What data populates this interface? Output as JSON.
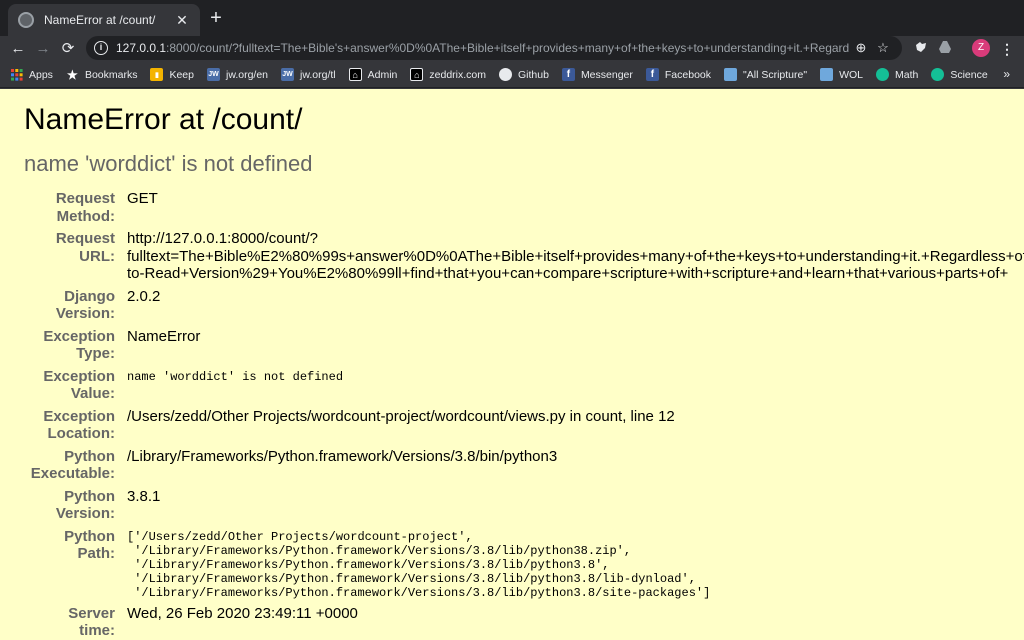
{
  "tab": {
    "title": "NameError at /count/",
    "close": "✕"
  },
  "new_tab_label": "+",
  "toolbar": {
    "back": "←",
    "forward": "→",
    "reload": "⟳",
    "url_host": "127.0.0.1",
    "url_rest": ":8000/count/?fulltext=The+Bible's+answer%0D%0AThe+Bible+itself+provides+many+of+the+keys+to+understanding+it.+Regardless...",
    "zoom": "⊕",
    "star": "☆",
    "profile_initial": "Z",
    "menu": "⋮"
  },
  "bookmarks": [
    {
      "label": "Apps",
      "icon": "apps-grid-icon",
      "color": "#4285f4"
    },
    {
      "label": "Bookmarks",
      "icon": "star-icon",
      "color": "#35363a"
    },
    {
      "label": "Keep",
      "icon": "keep-icon",
      "color": "#f4b400"
    },
    {
      "label": "jw.org/en",
      "icon": "jw-icon",
      "color": "#4a6da7"
    },
    {
      "label": "jw.org/tl",
      "icon": "jw-icon",
      "color": "#4a6da7"
    },
    {
      "label": "Admin",
      "icon": "home-icon",
      "color": "#000000"
    },
    {
      "label": "zeddrix.com",
      "icon": "home-icon",
      "color": "#000000"
    },
    {
      "label": "Github",
      "icon": "github-icon",
      "color": "#111111"
    },
    {
      "label": "Messenger",
      "icon": "facebook-icon",
      "color": "#3b5998"
    },
    {
      "label": "Facebook",
      "icon": "facebook-icon",
      "color": "#3b5998"
    },
    {
      "label": "\"All Scripture\"",
      "icon": "book-icon",
      "color": "#6fa8dc"
    },
    {
      "label": "WOL",
      "icon": "book-icon",
      "color": "#6fa8dc"
    },
    {
      "label": "Math",
      "icon": "khan-icon",
      "color": "#14bf96"
    },
    {
      "label": "Science",
      "icon": "khan-icon",
      "color": "#14bf96"
    }
  ],
  "bookmarks_more": "»",
  "error": {
    "title": "NameError at /count/",
    "subtitle": "name 'worddict' is not defined",
    "rows": [
      {
        "key": "Request Method:",
        "value": "GET",
        "mono": false
      },
      {
        "key": "Request URL:",
        "value": "http://127.0.0.1:8000/count/?\nfulltext=The+Bible%E2%80%99s+answer%0D%0AThe+Bible+itself+provides+many+of+the+keys+to+understanding+it.+Regardless+of+\nto-Read+Version%29+You%E2%80%99ll+find+that+you+can+compare+scripture+with+scripture+and+learn+that+various+parts+of+",
        "mono": false
      },
      {
        "key": "Django Version:",
        "value": "2.0.2",
        "mono": false
      },
      {
        "key": "Exception Type:",
        "value": "NameError",
        "mono": false
      },
      {
        "key": "Exception Value:",
        "value": "name 'worddict' is not defined",
        "mono": true
      },
      {
        "key": "Exception Location:",
        "value": "/Users/zedd/Other Projects/wordcount-project/wordcount/views.py in count, line 12",
        "mono": false
      },
      {
        "key": "Python Executable:",
        "value": "/Library/Frameworks/Python.framework/Versions/3.8/bin/python3",
        "mono": false
      },
      {
        "key": "Python Version:",
        "value": "3.8.1",
        "mono": false
      },
      {
        "key": "Python Path:",
        "value": "['/Users/zedd/Other Projects/wordcount-project',\n '/Library/Frameworks/Python.framework/Versions/3.8/lib/python38.zip',\n '/Library/Frameworks/Python.framework/Versions/3.8/lib/python3.8',\n '/Library/Frameworks/Python.framework/Versions/3.8/lib/python3.8/lib-dynload',\n '/Library/Frameworks/Python.framework/Versions/3.8/lib/python3.8/site-packages']",
        "mono": true
      },
      {
        "key": "Server time:",
        "value": "Wed, 26 Feb 2020 23:49:11 +0000",
        "mono": false
      }
    ]
  }
}
